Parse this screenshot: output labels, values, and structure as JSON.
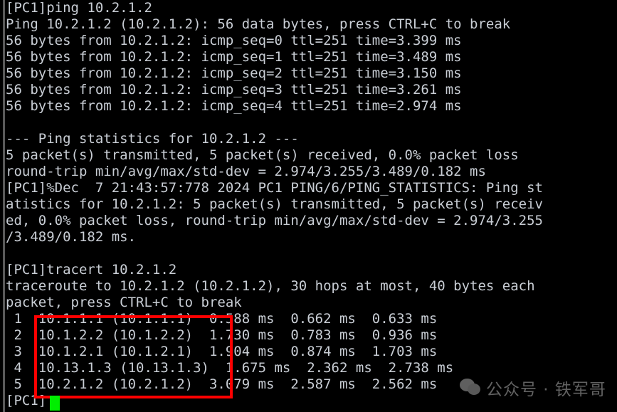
{
  "terminal": {
    "device": "PC1",
    "prompt": "[PC1]",
    "foreground_color": "#c8cdd4",
    "background_color": "#000000",
    "cursor_color": "#00ef00",
    "annotation_color": "#fe0000",
    "lines": [
      "[PC1]ping 10.2.1.2",
      "Ping 10.2.1.2 (10.2.1.2): 56 data bytes, press CTRL+C to break",
      "56 bytes from 10.2.1.2: icmp_seq=0 ttl=251 time=3.399 ms",
      "56 bytes from 10.2.1.2: icmp_seq=1 ttl=251 time=3.489 ms",
      "56 bytes from 10.2.1.2: icmp_seq=2 ttl=251 time=3.150 ms",
      "56 bytes from 10.2.1.2: icmp_seq=3 ttl=251 time=3.261 ms",
      "56 bytes from 10.2.1.2: icmp_seq=4 ttl=251 time=2.974 ms",
      "",
      "--- Ping statistics for 10.2.1.2 ---",
      "5 packet(s) transmitted, 5 packet(s) received, 0.0% packet loss",
      "round-trip min/avg/max/std-dev = 2.974/3.255/3.489/0.182 ms",
      "[PC1]%Dec  7 21:43:57:778 2024 PC1 PING/6/PING_STATISTICS: Ping st",
      "atistics for 10.2.1.2: 5 packet(s) transmitted, 5 packet(s) receiv",
      "ed, 0.0% packet loss, round-trip min/avg/max/std-dev = 2.974/3.255",
      "/3.489/0.182 ms.",
      "",
      "[PC1]tracert 10.2.1.2",
      "traceroute to 10.2.1.2 (10.2.1.2), 30 hops at most, 40 bytes each",
      "packet, press CTRL+C to break",
      " 1  10.1.1.1 (10.1.1.1)  0.588 ms  0.662 ms  0.633 ms",
      " 2  10.1.2.2 (10.1.2.2)  1.730 ms  0.783 ms  0.936 ms",
      " 3  10.1.2.1 (10.1.2.1)  1.904 ms  0.874 ms  1.703 ms",
      " 4  10.13.1.3 (10.13.1.3)  1.675 ms  2.362 ms  2.738 ms",
      " 5  10.2.1.2 (10.2.1.2)  3.079 ms  2.587 ms  2.562 ms",
      "[PC1]"
    ],
    "ping": {
      "command": "ping 10.2.1.2",
      "target": "10.2.1.2",
      "data_bytes": 56,
      "replies": [
        {
          "bytes": 56,
          "from": "10.2.1.2",
          "icmp_seq": 0,
          "ttl": 251,
          "time_ms": "3.399"
        },
        {
          "bytes": 56,
          "from": "10.2.1.2",
          "icmp_seq": 1,
          "ttl": 251,
          "time_ms": "3.489"
        },
        {
          "bytes": 56,
          "from": "10.2.1.2",
          "icmp_seq": 2,
          "ttl": 251,
          "time_ms": "3.150"
        },
        {
          "bytes": 56,
          "from": "10.2.1.2",
          "icmp_seq": 3,
          "ttl": 251,
          "time_ms": "3.261"
        },
        {
          "bytes": 56,
          "from": "10.2.1.2",
          "icmp_seq": 4,
          "ttl": 251,
          "time_ms": "2.974"
        }
      ],
      "transmitted": 5,
      "received": 5,
      "packet_loss": "0.0%",
      "min_ms": "2.974",
      "avg_ms": "3.255",
      "max_ms": "3.489",
      "std_dev_ms": "0.182"
    },
    "log": {
      "timestamp": "%Dec  7 21:43:57:778 2024",
      "device": "PC1",
      "module": "PING/6/PING_STATISTICS"
    },
    "tracert": {
      "command": "tracert 10.2.1.2",
      "target": "10.2.1.2",
      "max_hops": 30,
      "packet_bytes": 40,
      "hops": [
        {
          "n": "1",
          "host": "10.1.1.1",
          "ip": "10.1.1.1",
          "t1": "0.588",
          "t2": "0.662",
          "t3": "0.633"
        },
        {
          "n": "2",
          "host": "10.1.2.2",
          "ip": "10.1.2.2",
          "t1": "1.730",
          "t2": "0.783",
          "t3": "0.936"
        },
        {
          "n": "3",
          "host": "10.1.2.1",
          "ip": "10.1.2.1",
          "t1": "1.904",
          "t2": "0.874",
          "t3": "1.703"
        },
        {
          "n": "4",
          "host": "10.13.1.3",
          "ip": "10.13.1.3",
          "t1": "1.675",
          "t2": "2.362",
          "t3": "2.738"
        },
        {
          "n": "5",
          "host": "10.2.1.2",
          "ip": "10.2.1.2",
          "t1": "3.079",
          "t2": "2.587",
          "t3": "2.562"
        }
      ]
    }
  },
  "watermark": {
    "icon": "wechat-icon",
    "text": "公众号 · 铁军哥"
  }
}
